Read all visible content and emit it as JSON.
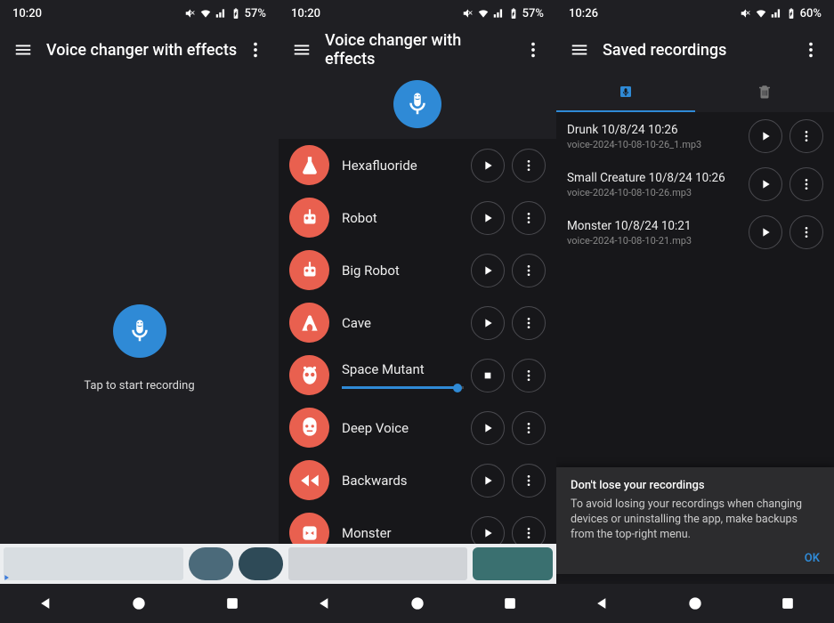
{
  "screen1": {
    "status": {
      "time": "10:20",
      "battery": "57%"
    },
    "title": "Voice changer with effects",
    "tapText": "Tap to start recording"
  },
  "screen2": {
    "status": {
      "time": "10:20",
      "battery": "57%"
    },
    "title": "Voice changer with effects",
    "effects": [
      {
        "name": "Hexafluoride",
        "playing": false
      },
      {
        "name": "Robot",
        "playing": false
      },
      {
        "name": "Big Robot",
        "playing": false
      },
      {
        "name": "Cave",
        "playing": false
      },
      {
        "name": "Space Mutant",
        "playing": true,
        "progress": 95
      },
      {
        "name": "Deep Voice",
        "playing": false
      },
      {
        "name": "Backwards",
        "playing": false
      },
      {
        "name": "Monster",
        "playing": false
      }
    ]
  },
  "screen3": {
    "status": {
      "time": "10:26",
      "battery": "60%"
    },
    "title": "Saved recordings",
    "recordings": [
      {
        "title": "Drunk 10/8/24 10:26",
        "file": "voice-2024-10-08-10-26_1.mp3"
      },
      {
        "title": "Small Creature 10/8/24 10:26",
        "file": "voice-2024-10-08-10-26.mp3"
      },
      {
        "title": "Monster 10/8/24 10:21",
        "file": "voice-2024-10-08-10-21.mp3"
      }
    ],
    "snack": {
      "title": "Don't lose your recordings",
      "body": "To avoid losing your recordings when changing devices or uninstalling the app, make backups from the top-right menu.",
      "action": "OK"
    }
  }
}
